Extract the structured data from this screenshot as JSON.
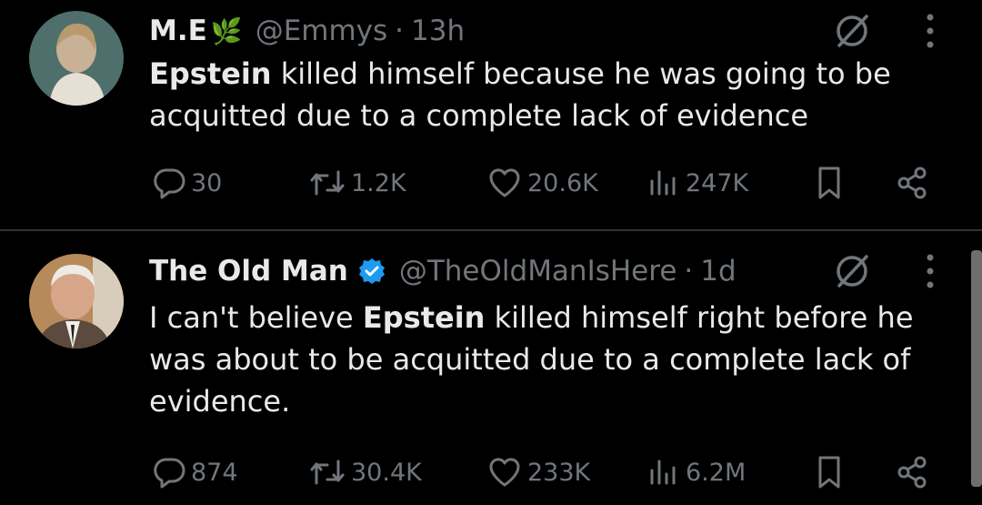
{
  "tweets": [
    {
      "display_name": "M.E",
      "name_emoji": "🌿",
      "handle": "@Emmys",
      "separator": "·",
      "time": "13h",
      "bold_lead": "Epstein",
      "text_rest": " killed himself because he was going to be acquitted due to a complete lack of evidence",
      "verified": false,
      "replies": "30",
      "retweets": "1.2K",
      "likes": "20.6K",
      "views": "247K"
    },
    {
      "display_name": "The Old Man",
      "handle": "@TheOldManIsHere",
      "separator": "·",
      "time": "1d",
      "text_pre": "I can't believe ",
      "bold_mid": "Epstein",
      "text_rest": " killed himself right before he was about to be acquitted due to a complete lack of evidence.",
      "verified": true,
      "replies": "874",
      "retweets": "30.4K",
      "likes": "233K",
      "views": "6.2M"
    }
  ],
  "colors": {
    "background": "#000000",
    "text": "#e7e9ea",
    "muted": "#71767b",
    "divider": "#2f3336",
    "verified": "#1d9bf0"
  },
  "icons": [
    "grok-icon",
    "more-icon",
    "reply-icon",
    "retweet-icon",
    "like-icon",
    "views-icon",
    "bookmark-icon",
    "share-icon",
    "verified-badge-icon"
  ]
}
